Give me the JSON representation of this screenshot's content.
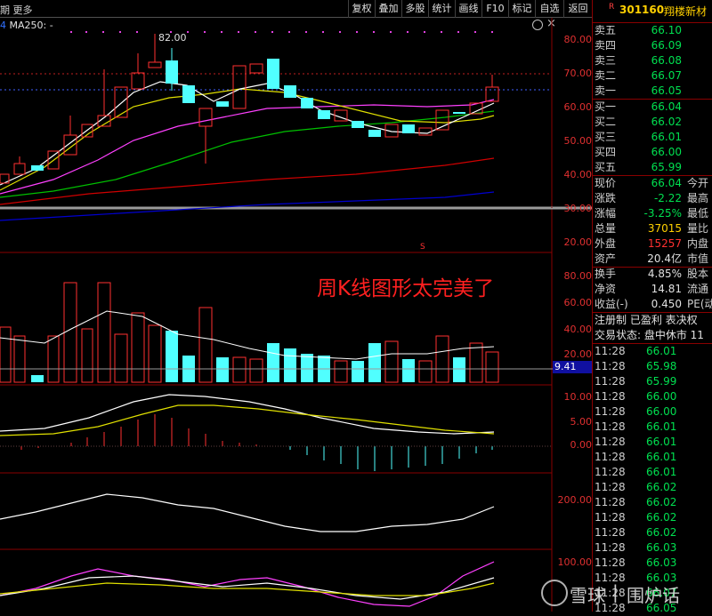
{
  "toolbar": {
    "left_text": "期 更多",
    "buttons": [
      "复权",
      "叠加",
      "多股",
      "统计",
      "画线",
      "F10",
      "标记",
      "自选",
      "返回"
    ]
  },
  "chart": {
    "ma_label": "MA250: -",
    "high_marker": "82.00",
    "price_axis": [
      "80.00",
      "70.00",
      "60.00",
      "50.00",
      "40.00",
      "30.00",
      "20.00"
    ],
    "vol_axis": [
      "80.00",
      "60.00",
      "40.00",
      "20.00"
    ],
    "vol_value": "9.41",
    "macd_axis": [
      "10.00",
      "5.00",
      "0.00"
    ],
    "cci_axis": [
      "200.00"
    ],
    "kdj_axis": [
      "100.00"
    ],
    "overlay_caption": "周K线图形太完美了",
    "marker_s": "S"
  },
  "quote": {
    "r_tag": "R",
    "code": "301160",
    "name": "翔楼新材",
    "asks": [
      {
        "label": "卖五",
        "price": "66.10"
      },
      {
        "label": "卖四",
        "price": "66.09"
      },
      {
        "label": "卖三",
        "price": "66.08"
      },
      {
        "label": "卖二",
        "price": "66.07"
      },
      {
        "label": "卖一",
        "price": "66.05"
      }
    ],
    "bids": [
      {
        "label": "买一",
        "price": "66.04"
      },
      {
        "label": "买二",
        "price": "66.02"
      },
      {
        "label": "买三",
        "price": "66.01"
      },
      {
        "label": "买四",
        "price": "66.00"
      },
      {
        "label": "买五",
        "price": "65.99"
      }
    ],
    "stats": [
      {
        "label": "现价",
        "value": "66.04",
        "extra": "今开",
        "color": "#00e050"
      },
      {
        "label": "涨跌",
        "value": "-2.22",
        "extra": "最高",
        "color": "#00e050"
      },
      {
        "label": "涨幅",
        "value": "-3.25%",
        "extra": "最低",
        "color": "#00e050"
      },
      {
        "label": "总量",
        "value": "37015",
        "extra": "量比",
        "color": "#ffd000"
      },
      {
        "label": "外盘",
        "value": "15257",
        "extra": "内盘",
        "color": "#ff3030"
      },
      {
        "label": "资产",
        "value": "20.4亿",
        "extra": "市值",
        "color": "#e0e0e0"
      }
    ],
    "stats2": [
      {
        "label": "换手",
        "value": "4.85%",
        "extra": "股本",
        "color": "#e0e0e0"
      },
      {
        "label": "净资",
        "value": "14.81",
        "extra": "流通",
        "color": "#e0e0e0"
      },
      {
        "label": "收益(-)",
        "value": "0.450",
        "extra": "PE(动",
        "color": "#e0e0e0"
      }
    ],
    "note1": "注册制 已盈利 表决权",
    "note2": "交易状态: 盘中休市 11",
    "ticks": [
      {
        "time": "11:28",
        "price": "66.01"
      },
      {
        "time": "11:28",
        "price": "65.98"
      },
      {
        "time": "11:28",
        "price": "65.99"
      },
      {
        "time": "11:28",
        "price": "66.00"
      },
      {
        "time": "11:28",
        "price": "66.00"
      },
      {
        "time": "11:28",
        "price": "66.01"
      },
      {
        "time": "11:28",
        "price": "66.01"
      },
      {
        "time": "11:28",
        "price": "66.01"
      },
      {
        "time": "11:28",
        "price": "66.01"
      },
      {
        "time": "11:28",
        "price": "66.02"
      },
      {
        "time": "11:28",
        "price": "66.02"
      },
      {
        "time": "11:28",
        "price": "66.02"
      },
      {
        "time": "11:28",
        "price": "66.02"
      },
      {
        "time": "11:28",
        "price": "66.03"
      },
      {
        "time": "11:28",
        "price": "66.03"
      },
      {
        "time": "11:28",
        "price": "66.03"
      },
      {
        "time": "11:28",
        "price": "66.07"
      },
      {
        "time": "11:28",
        "price": "66.05"
      }
    ]
  },
  "watermark": {
    "brand": "雪球",
    "sep": "|",
    "user": "围炉话"
  }
}
